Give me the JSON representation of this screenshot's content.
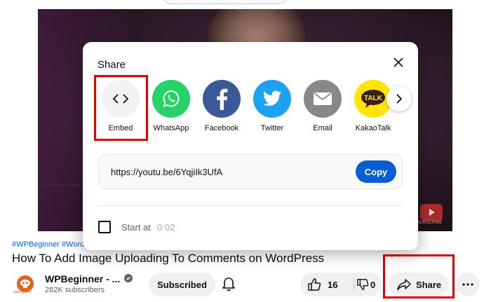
{
  "video": {
    "hashtags": "#WPBeginner #Word",
    "title": "How To Add Image Uploading To Comments on WordPress",
    "watermark_text": "SUBSCRIBE"
  },
  "channel": {
    "name": "WPBeginner - ...",
    "subscribers": "282K subscribers",
    "avatar_text": "wpbeginner"
  },
  "actions": {
    "subscribed_label": "Subscribed",
    "like_count": "16",
    "dislike_count": "0",
    "share_label": "Share"
  },
  "share_dialog": {
    "title": "Share",
    "targets": [
      {
        "label": "Embed",
        "color": "#f2f2f2"
      },
      {
        "label": "WhatsApp",
        "color": "#25d366"
      },
      {
        "label": "Facebook",
        "color": "#3b5998"
      },
      {
        "label": "Twitter",
        "color": "#1da1f2"
      },
      {
        "label": "Email",
        "color": "#888888"
      },
      {
        "label": "KakaoTalk",
        "color": "#fee500",
        "icon_text": "TALK"
      }
    ],
    "url": "https://youtu.be/6YqjiIk3UfA",
    "copy_label": "Copy",
    "start_at_label": "Start at",
    "start_time": "0:02"
  },
  "colors": {
    "highlight": "#e00000",
    "accent": "#065fd4"
  }
}
